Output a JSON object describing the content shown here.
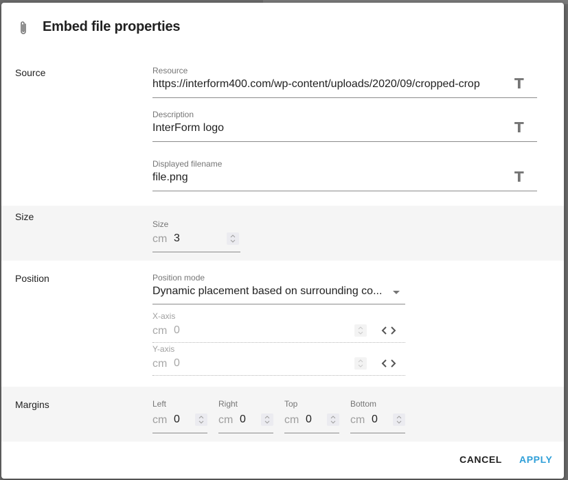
{
  "dialog": {
    "title": "Embed file properties",
    "icon": "paperclip-icon"
  },
  "sections": {
    "source": {
      "label": "Source",
      "resource": {
        "label": "Resource",
        "value": "https://interform400.com/wp-content/uploads/2020/09/cropped-crop",
        "icon": "text-format-icon"
      },
      "description": {
        "label": "Description",
        "value": "InterForm logo",
        "icon": "text-format-icon"
      },
      "filename": {
        "label": "Displayed filename",
        "value": "file.png",
        "icon": "text-format-icon"
      }
    },
    "size": {
      "label": "Size",
      "size": {
        "label": "Size",
        "unit": "cm",
        "value": "3"
      }
    },
    "position": {
      "label": "Position",
      "mode": {
        "label": "Position mode",
        "value": "Dynamic placement based on surrounding co..."
      },
      "x_axis": {
        "label": "X-axis",
        "unit": "cm",
        "value": "0"
      },
      "y_axis": {
        "label": "Y-axis",
        "unit": "cm",
        "value": "0"
      }
    },
    "margins": {
      "label": "Margins",
      "left": {
        "label": "Left",
        "unit": "cm",
        "value": "0"
      },
      "right": {
        "label": "Right",
        "unit": "cm",
        "value": "0"
      },
      "top": {
        "label": "Top",
        "unit": "cm",
        "value": "0"
      },
      "bottom": {
        "label": "Bottom",
        "unit": "cm",
        "value": "0"
      }
    }
  },
  "actions": {
    "cancel": "CANCEL",
    "apply": "APPLY",
    "apply_color": "#2f9fd8"
  }
}
